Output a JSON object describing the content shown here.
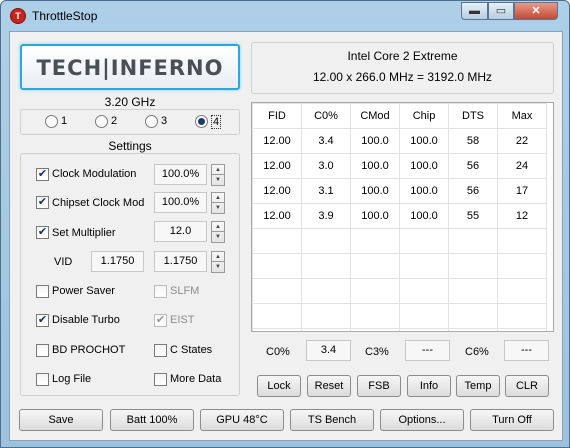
{
  "window": {
    "title": "ThrottleStop",
    "icon": "T",
    "min_glyph": "▬",
    "max_glyph": "▭",
    "close_glyph": "✕"
  },
  "logo": {
    "text": "TECH|INFERNO"
  },
  "cpu": {
    "name": "Intel Core 2 Extreme",
    "freq_line": "12.00 x 266.0 MHz = 3192.0 MHz"
  },
  "speed": {
    "label": "3.20 GHz",
    "profiles": [
      {
        "label": "1",
        "selected": false
      },
      {
        "label": "2",
        "selected": false
      },
      {
        "label": "3",
        "selected": false
      },
      {
        "label": "4",
        "selected": true
      }
    ]
  },
  "settings": {
    "title": "Settings",
    "clock_modulation": {
      "label": "Clock Modulation",
      "checked": true,
      "value": "100.0%"
    },
    "chipset_clock_mod": {
      "label": "Chipset Clock Mod",
      "checked": true,
      "value": "100.0%"
    },
    "set_multiplier": {
      "label": "Set Multiplier",
      "checked": true,
      "value": "12.0"
    },
    "vid": {
      "label": "VID",
      "value1": "1.1750",
      "value2": "1.1750"
    },
    "power_saver": {
      "label": "Power Saver",
      "checked": false
    },
    "slfm": {
      "label": "SLFM",
      "checked": false
    },
    "disable_turbo": {
      "label": "Disable Turbo",
      "checked": true
    },
    "eist": {
      "label": "EIST",
      "checked": true
    },
    "bd_prochot": {
      "label": "BD PROCHOT",
      "checked": false
    },
    "c_states": {
      "label": "C States",
      "checked": false
    },
    "log_file": {
      "label": "Log File",
      "checked": false
    },
    "more_data": {
      "label": "More Data",
      "checked": false
    }
  },
  "table": {
    "headers": [
      "FID",
      "C0%",
      "CMod",
      "Chip",
      "DTS",
      "Max"
    ],
    "rows": [
      [
        "12.00",
        "3.4",
        "100.0",
        "100.0",
        "58",
        "22"
      ],
      [
        "12.00",
        "3.0",
        "100.0",
        "100.0",
        "56",
        "24"
      ],
      [
        "12.00",
        "3.1",
        "100.0",
        "100.0",
        "56",
        "17"
      ],
      [
        "12.00",
        "3.9",
        "100.0",
        "100.0",
        "55",
        "12"
      ]
    ]
  },
  "cstate": {
    "c0_label": "C0%",
    "c0_value": "3.4",
    "c3_label": "C3%",
    "c3_value": "---",
    "c6_label": "C6%",
    "c6_value": "---"
  },
  "actions": {
    "lock": "Lock",
    "reset": "Reset",
    "fsb": "FSB",
    "info": "Info",
    "temp": "Temp",
    "clr": "CLR"
  },
  "bottom": {
    "save": "Save",
    "batt": "Batt 100%",
    "gpu": "GPU 48°C",
    "ts_bench": "TS Bench",
    "options": "Options...",
    "turn_off": "Turn Off"
  }
}
